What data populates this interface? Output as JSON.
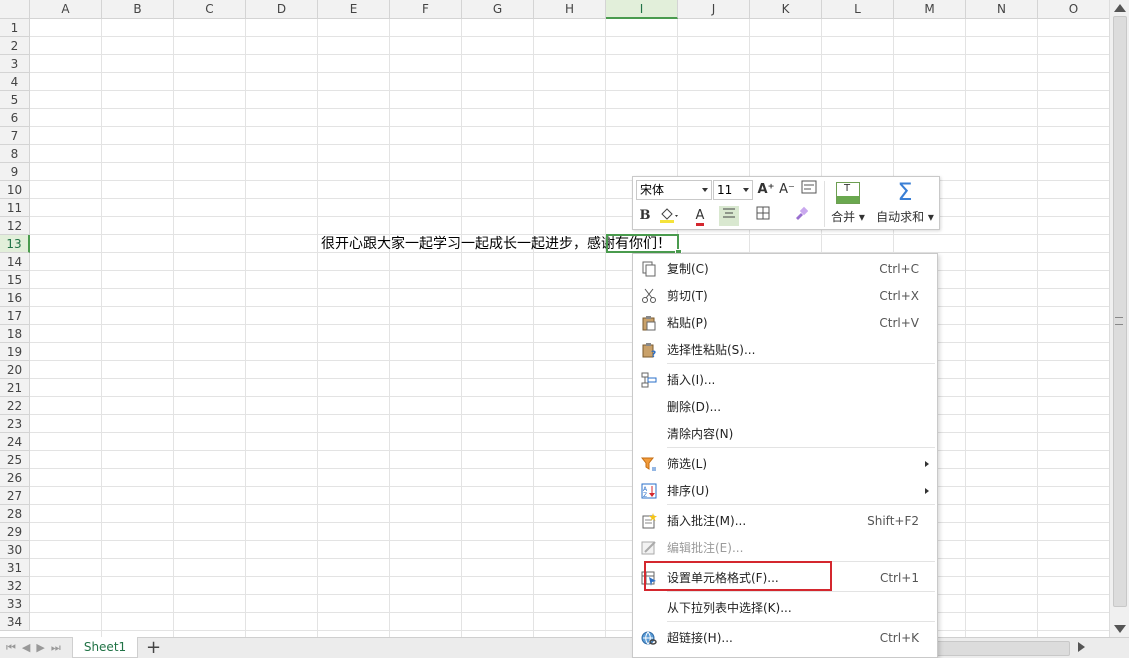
{
  "columns": [
    "A",
    "B",
    "C",
    "D",
    "E",
    "F",
    "G",
    "H",
    "I",
    "J",
    "K",
    "L",
    "M",
    "N",
    "O"
  ],
  "active_column": "I",
  "rows": [
    "1",
    "2",
    "3",
    "4",
    "5",
    "6",
    "7",
    "8",
    "9",
    "10",
    "11",
    "12",
    "13",
    "14",
    "15",
    "16",
    "17",
    "18",
    "19",
    "20",
    "21",
    "22",
    "23",
    "24",
    "25",
    "26",
    "27",
    "28",
    "29",
    "30",
    "31",
    "32",
    "33",
    "34"
  ],
  "active_row": "13",
  "cell_content": "很开心跟大家一起学习一起成长一起进步，感谢有你们！",
  "sheet_tab": "Sheet1",
  "add_sheet": "+",
  "mini_toolbar": {
    "font": "宋体",
    "size": "11",
    "grow_font": "A⁺",
    "shrink_font": "A⁻",
    "bold": "B",
    "font_color": "A",
    "merge_label": "合并",
    "autosum_label": "自动求和",
    "merge_icon": "T",
    "autosum_icon": "Σ"
  },
  "context_menu": {
    "items": [
      {
        "label": "复制(C)",
        "shortcut": "Ctrl+C",
        "icon": "copy-icon"
      },
      {
        "label": "剪切(T)",
        "shortcut": "Ctrl+X",
        "icon": "scissors-icon"
      },
      {
        "label": "粘贴(P)",
        "shortcut": "Ctrl+V",
        "icon": "paste-icon"
      },
      {
        "label": "选择性粘贴(S)...",
        "shortcut": "",
        "icon": "paste-special-icon"
      },
      {
        "label": "插入(I)...",
        "shortcut": "",
        "icon": "insert-icon"
      },
      {
        "label": "删除(D)...",
        "shortcut": "",
        "icon": ""
      },
      {
        "label": "清除内容(N)",
        "shortcut": "",
        "icon": ""
      },
      {
        "label": "筛选(L)",
        "shortcut": "",
        "icon": "filter-icon"
      },
      {
        "label": "排序(U)",
        "shortcut": "",
        "icon": "sort-icon"
      },
      {
        "label": "插入批注(M)...",
        "shortcut": "Shift+F2",
        "icon": "insert-comment-icon"
      },
      {
        "label": "编辑批注(E)...",
        "shortcut": "",
        "icon": "edit-comment-icon"
      },
      {
        "label": "设置单元格格式(F)...",
        "shortcut": "Ctrl+1",
        "icon": "format-cells-icon"
      },
      {
        "label": "从下拉列表中选择(K)...",
        "shortcut": "",
        "icon": ""
      },
      {
        "label": "超链接(H)...",
        "shortcut": "Ctrl+K",
        "icon": "hyperlink-icon"
      }
    ]
  },
  "colors": {
    "accent_green": "#4a9b4e",
    "highlight_red": "#d4272e",
    "header_bg": "#f2f2f2"
  }
}
